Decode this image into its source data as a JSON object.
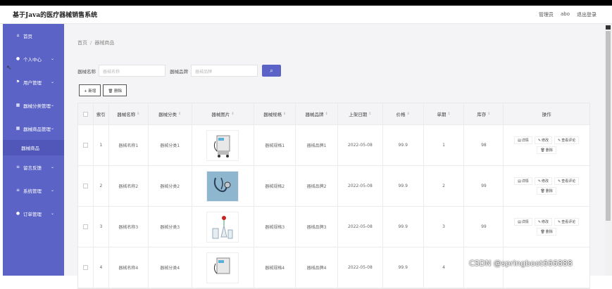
{
  "header": {
    "title": "基于Java的医疗器械销售系统",
    "role": "管理员",
    "user": "abo",
    "logout": "退出登录"
  },
  "sidebar": {
    "items": [
      {
        "label": "首页",
        "icon": "home-icon"
      },
      {
        "label": "个人中心",
        "icon": "user-icon"
      },
      {
        "label": "用户管理",
        "icon": "flag-icon"
      },
      {
        "label": "器械分类管理",
        "icon": "grid-icon"
      },
      {
        "label": "器械商品管理",
        "icon": "grid-icon"
      },
      {
        "label": "器械商品",
        "icon": ""
      },
      {
        "label": "留言反馈",
        "icon": "list-icon"
      },
      {
        "label": "系统管理",
        "icon": "list-icon"
      },
      {
        "label": "订单管理",
        "icon": "pin-icon"
      }
    ]
  },
  "breadcrumb": {
    "home": "首页",
    "sep": "/",
    "current": "器械商品"
  },
  "search": {
    "name_label": "器械名称",
    "name_placeholder": "器械名称",
    "brand_label": "器械品牌",
    "brand_placeholder": "器械品牌"
  },
  "toolbar": {
    "add_label": "+ 新增",
    "delete_label": "🗑 删除"
  },
  "table": {
    "headers": [
      "索引",
      "器械名称",
      "器械分类",
      "器械图片",
      "器械规格",
      "器械品牌",
      "上架日期",
      "价格",
      "单期",
      "库存",
      "操作"
    ],
    "rows": [
      {
        "index": "1",
        "name": "器械名称1",
        "category": "器械分类1",
        "spec": "器械规格1",
        "brand": "器械品牌1",
        "date": "2022-05-08",
        "price": "99.9",
        "period": "1",
        "stock": "98"
      },
      {
        "index": "2",
        "name": "器械名称2",
        "category": "器械分类2",
        "spec": "器械规格2",
        "brand": "器械品牌2",
        "date": "2022-05-08",
        "price": "99.9",
        "period": "2",
        "stock": "99"
      },
      {
        "index": "3",
        "name": "器械名称3",
        "category": "器械分类3",
        "spec": "器械规格3",
        "brand": "器械品牌3",
        "date": "2022-05-08",
        "price": "99.9",
        "period": "3",
        "stock": "99"
      },
      {
        "index": "4",
        "name": "器械名称4",
        "category": "器械分类4",
        "spec": "器械规格4",
        "brand": "器械品牌4",
        "date": "2022-05-08",
        "price": "99.9",
        "period": "4",
        "stock": ""
      }
    ],
    "ops": {
      "detail": "详情",
      "edit": "修改",
      "review": "查看评论",
      "delete": "删除"
    }
  },
  "watermark": "CSDN @springboot666888",
  "colors": {
    "sidebar": "#5b63c6",
    "accent": "#5b63c6"
  }
}
